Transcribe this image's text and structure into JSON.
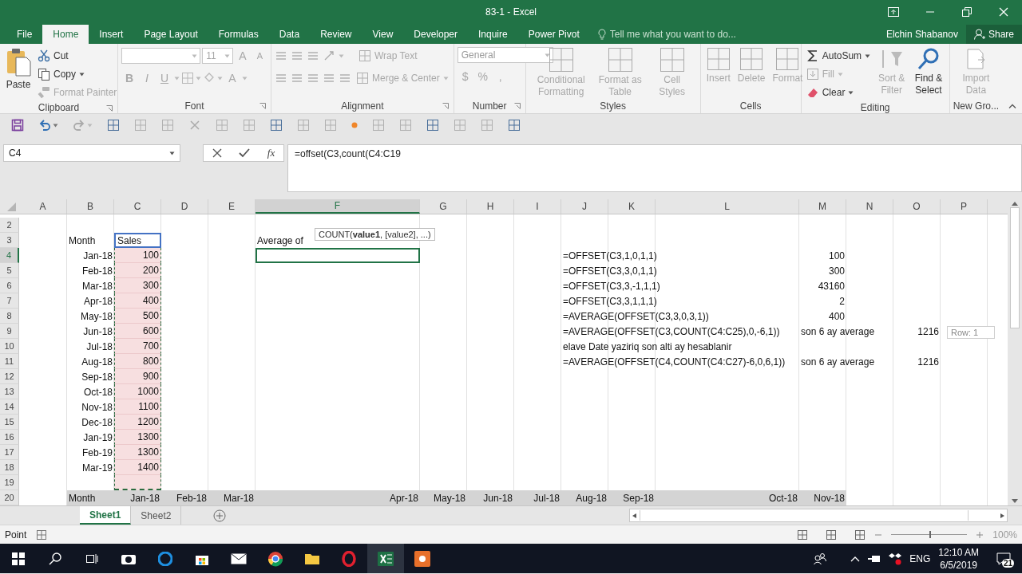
{
  "window": {
    "title": "83-1 - Excel"
  },
  "ribbon_tabs": [
    {
      "label": "File",
      "selected": false
    },
    {
      "label": "Home",
      "selected": true
    },
    {
      "label": "Insert",
      "selected": false
    },
    {
      "label": "Page Layout",
      "selected": false
    },
    {
      "label": "Formulas",
      "selected": false
    },
    {
      "label": "Data",
      "selected": false
    },
    {
      "label": "Review",
      "selected": false
    },
    {
      "label": "View",
      "selected": false
    },
    {
      "label": "Developer",
      "selected": false
    },
    {
      "label": "Inquire",
      "selected": false
    },
    {
      "label": "Power Pivot",
      "selected": false
    }
  ],
  "tell_me": {
    "placeholder": "Tell me what you want to do..."
  },
  "user": "Elchin Shabanov",
  "share": "Share",
  "clipboard": {
    "title": "Clipboard",
    "paste": {
      "label": "Paste",
      "disabled": false
    },
    "items": [
      {
        "label": "Cut",
        "disabled": false
      },
      {
        "label": "Copy",
        "disabled": false
      },
      {
        "label": "Format Painter",
        "disabled": true
      }
    ]
  },
  "font": {
    "title": "Font",
    "size": "11",
    "grow": "A",
    "shrink": "A",
    "styles": [
      "B",
      "I",
      "U"
    ],
    "color_glyph": "A",
    "disabled": true
  },
  "alignment": {
    "title": "Alignment",
    "items": [
      {
        "label": "Wrap Text",
        "disabled": true
      },
      {
        "label": "Merge & Center",
        "disabled": true
      }
    ]
  },
  "number": {
    "title": "Number",
    "format": "General",
    "glyphs": [
      "$",
      "%",
      ","
    ],
    "disabled": true
  },
  "styles": {
    "title": "Styles",
    "items": [
      {
        "label": "Conditional Formatting",
        "disabled": true
      },
      {
        "label": "Format as Table",
        "disabled": true
      },
      {
        "label": "Cell Styles",
        "disabled": true
      }
    ]
  },
  "cells": {
    "title": "Cells",
    "items": [
      {
        "label": "Insert",
        "disabled": true
      },
      {
        "label": "Delete",
        "disabled": true
      },
      {
        "label": "Format",
        "disabled": true
      }
    ]
  },
  "editing": {
    "title": "Editing",
    "small": [
      {
        "label": "AutoSum",
        "disabled": false
      },
      {
        "label": "Fill",
        "disabled": true
      },
      {
        "label": "Clear",
        "disabled": false
      }
    ],
    "large": [
      {
        "label": "Sort & Filter",
        "disabled": true
      },
      {
        "label": "Find & Select",
        "disabled": false
      }
    ]
  },
  "new_group": {
    "title": "New Gro...",
    "items": [
      {
        "label": "Import Data",
        "disabled": true
      }
    ]
  },
  "formula_bar": {
    "name_box": "C4",
    "function_label": "fx",
    "formula": "=offset(C3,count(C4:C19"
  },
  "columns": [
    {
      "label": "A",
      "selected": false
    },
    {
      "label": "B",
      "selected": false
    },
    {
      "label": "C",
      "selected": false
    },
    {
      "label": "D",
      "selected": false
    },
    {
      "label": "E",
      "selected": false
    },
    {
      "label": "F",
      "selected": true
    },
    {
      "label": "G",
      "selected": false
    },
    {
      "label": "H",
      "selected": false
    },
    {
      "label": "I",
      "selected": false
    },
    {
      "label": "J",
      "selected": false
    },
    {
      "label": "K",
      "selected": false
    },
    {
      "label": "L",
      "selected": false
    },
    {
      "label": "M",
      "selected": false
    },
    {
      "label": "N",
      "selected": false
    },
    {
      "label": "O",
      "selected": false
    },
    {
      "label": "P",
      "selected": false
    }
  ],
  "rows": [
    {
      "header": "2",
      "selected": false
    },
    {
      "header": "3",
      "selected": false,
      "kind": "plain",
      "cells": [
        {},
        {
          "text": "Month",
          "kind": "text"
        },
        {
          "text": "Sales",
          "kind": "source"
        },
        {},
        {},
        {
          "text": "Average of",
          "kind": "text"
        }
      ]
    },
    {
      "header": "4",
      "selected": true,
      "kind": "plain",
      "cells": [
        {},
        {
          "text": "Jan-18",
          "kind": "value"
        },
        {
          "text": "100",
          "kind": "referenced"
        },
        {},
        {},
        {
          "kind": "active"
        },
        {},
        {},
        {},
        {
          "text": "=OFFSET(C3,1,0,1,1)",
          "kind": "text"
        },
        {},
        {},
        {
          "text": "100",
          "kind": "value"
        }
      ]
    },
    {
      "header": "5",
      "selected": false,
      "kind": "plain",
      "cells": [
        {},
        {
          "text": "Feb-18",
          "kind": "value"
        },
        {
          "text": "200",
          "kind": "referenced"
        },
        {},
        {},
        {},
        {},
        {},
        {},
        {
          "text": " =OFFSET(C3,3,0,1,1)",
          "kind": "text"
        },
        {},
        {},
        {
          "text": "300",
          "kind": "value"
        }
      ]
    },
    {
      "header": "6",
      "selected": false,
      "kind": "plain",
      "cells": [
        {},
        {
          "text": "Mar-18",
          "kind": "value"
        },
        {
          "text": "300",
          "kind": "referenced"
        },
        {},
        {},
        {},
        {},
        {},
        {},
        {
          "text": "=OFFSET(C3,3,-1,1,1)",
          "kind": "text"
        },
        {},
        {},
        {
          "text": "43160",
          "kind": "value"
        }
      ]
    },
    {
      "header": "7",
      "selected": false,
      "kind": "plain",
      "cells": [
        {},
        {
          "text": "Apr-18",
          "kind": "value"
        },
        {
          "text": "400",
          "kind": "referenced"
        },
        {},
        {},
        {},
        {},
        {},
        {},
        {
          "text": "=OFFSET(C3,3,1,1,1)",
          "kind": "text"
        },
        {},
        {},
        {
          "text": "2",
          "kind": "value"
        }
      ]
    },
    {
      "header": "8",
      "selected": false,
      "kind": "plain",
      "cells": [
        {},
        {
          "text": "May-18",
          "kind": "value"
        },
        {
          "text": "500",
          "kind": "referenced"
        },
        {},
        {},
        {},
        {},
        {},
        {},
        {
          "text": "=AVERAGE(OFFSET(C3,3,0,3,1))",
          "kind": "text"
        },
        {},
        {},
        {
          "text": "400",
          "kind": "value"
        }
      ]
    },
    {
      "header": "9",
      "selected": false,
      "kind": "plain",
      "cells": [
        {},
        {
          "text": "Jun-18",
          "kind": "value"
        },
        {
          "text": "600",
          "kind": "referenced"
        },
        {},
        {},
        {},
        {},
        {},
        {},
        {
          "text": "=AVERAGE(OFFSET(C3,COUNT(C4:C25),0,-6,1))",
          "kind": "text"
        },
        {},
        {},
        {
          "text": "son 6 ay average",
          "kind": "text"
        },
        {},
        {
          "text": "1216",
          "kind": "value"
        }
      ]
    },
    {
      "header": "10",
      "selected": false,
      "kind": "plain",
      "cells": [
        {},
        {
          "text": "Jul-18",
          "kind": "value"
        },
        {
          "text": "700",
          "kind": "referenced"
        },
        {},
        {},
        {},
        {},
        {},
        {},
        {
          "text": "elave Date yaziriq son alti ay hesablanir",
          "kind": "text"
        }
      ]
    },
    {
      "header": "11",
      "selected": false,
      "kind": "plain",
      "cells": [
        {},
        {
          "text": "Aug-18",
          "kind": "value"
        },
        {
          "text": "800",
          "kind": "referenced"
        },
        {},
        {},
        {},
        {},
        {},
        {},
        {
          "text": "=AVERAGE(OFFSET(C4,COUNT(C4:C27)-6,0,6,1))",
          "kind": "text"
        },
        {},
        {},
        {
          "text": "son 6 ay average",
          "kind": "text"
        },
        {},
        {
          "text": "1216",
          "kind": "value"
        }
      ]
    },
    {
      "header": "12",
      "selected": false,
      "kind": "plain",
      "cells": [
        {},
        {
          "text": "Sep-18",
          "kind": "value"
        },
        {
          "text": "900",
          "kind": "referenced"
        }
      ]
    },
    {
      "header": "13",
      "selected": false,
      "kind": "plain",
      "cells": [
        {},
        {
          "text": "Oct-18",
          "kind": "value"
        },
        {
          "text": "1000",
          "kind": "referenced"
        }
      ]
    },
    {
      "header": "14",
      "selected": false,
      "kind": "plain",
      "cells": [
        {},
        {
          "text": "Nov-18",
          "kind": "value"
        },
        {
          "text": "1100",
          "kind": "referenced"
        }
      ]
    },
    {
      "header": "15",
      "selected": false,
      "kind": "plain",
      "cells": [
        {},
        {
          "text": "Dec-18",
          "kind": "value"
        },
        {
          "text": "1200",
          "kind": "referenced"
        }
      ]
    },
    {
      "header": "16",
      "selected": false,
      "kind": "plain",
      "cells": [
        {},
        {
          "text": "Jan-19",
          "kind": "value"
        },
        {
          "text": "1300",
          "kind": "referenced"
        }
      ]
    },
    {
      "header": "17",
      "selected": false,
      "kind": "plain",
      "cells": [
        {},
        {
          "text": "Feb-19",
          "kind": "value"
        },
        {
          "text": "1300",
          "kind": "referenced"
        }
      ]
    },
    {
      "header": "18",
      "selected": false,
      "kind": "plain",
      "cells": [
        {},
        {
          "text": "Mar-19",
          "kind": "value"
        },
        {
          "text": "1400",
          "kind": "referenced"
        }
      ]
    },
    {
      "header": "19",
      "selected": false,
      "kind": "plain",
      "cells": [
        {},
        {},
        {
          "kind": "referenced"
        }
      ]
    },
    {
      "header": "20",
      "selected": false,
      "kind": "shaded",
      "cells": [
        {},
        {
          "text": "Month",
          "kind": "text"
        },
        {
          "text": "Jan-18",
          "kind": "value"
        },
        {
          "text": "Feb-18",
          "kind": "value"
        },
        {
          "text": "Mar-18",
          "kind": "value"
        },
        {
          "text": "Apr-18",
          "kind": "value"
        },
        {
          "text": "May-18",
          "kind": "value"
        },
        {
          "text": "Jun-18",
          "kind": "value"
        },
        {
          "text": "Jul-18",
          "kind": "value"
        },
        {
          "text": "Aug-18",
          "kind": "value"
        },
        {
          "text": "Sep-18",
          "kind": "value"
        },
        {
          "text": "Oct-18",
          "kind": "value"
        },
        {
          "text": "Nov-18",
          "kind": "value"
        }
      ]
    }
  ],
  "function_tooltip": "COUNT(**value1**, [value2], ...)",
  "row_tooltip": "Row: 1",
  "sheets": [
    {
      "label": "Sheet1",
      "selected": true
    },
    {
      "label": "Sheet2",
      "selected": false
    }
  ],
  "status": "Point",
  "zoom": {
    "level": 0.5,
    "reading": "100%"
  },
  "taskbar": {
    "language": "ENG",
    "time": "12:10 AM",
    "date": "6/5/2019",
    "notifications": "21"
  }
}
